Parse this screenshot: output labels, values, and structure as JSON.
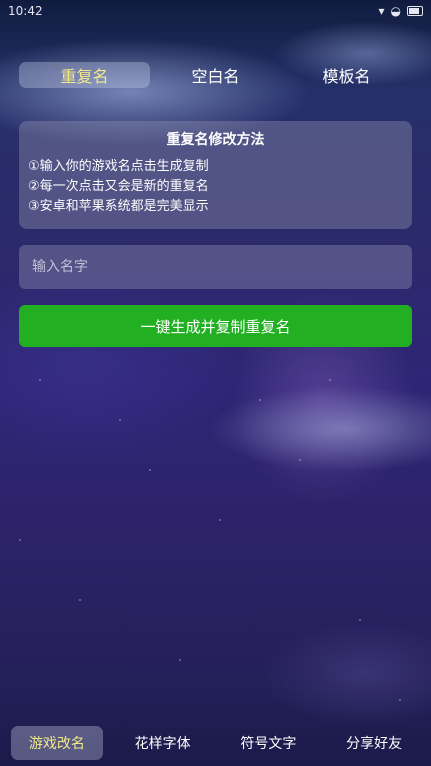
{
  "status_bar": {
    "time": "10:42",
    "icons": [
      "notification-icon",
      "signal-icon",
      "wifi-icon",
      "battery-icon"
    ]
  },
  "top_tabs": [
    {
      "label": "重复名",
      "active": true
    },
    {
      "label": "空白名",
      "active": false
    },
    {
      "label": "模板名",
      "active": false
    }
  ],
  "info": {
    "title": "重复名修改方法",
    "lines": [
      "①输入你的游戏名点击生成复制",
      "②每一次点击又会是新的重复名",
      "③安卓和苹果系统都是完美显示"
    ]
  },
  "input": {
    "placeholder": "输入名字",
    "value": ""
  },
  "generate_button": {
    "label": "一键生成并复制重复名"
  },
  "bottom_nav": [
    {
      "label": "游戏改名",
      "active": true
    },
    {
      "label": "花样字体",
      "active": false
    },
    {
      "label": "符号文字",
      "active": false
    },
    {
      "label": "分享好友",
      "active": false
    }
  ],
  "colors": {
    "accent_green": "#22b022",
    "active_text": "#f3e98a",
    "background": "#2b2a6a"
  }
}
